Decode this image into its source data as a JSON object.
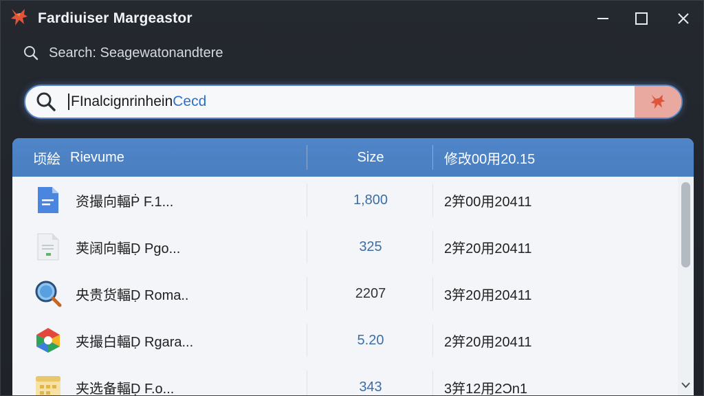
{
  "window": {
    "title": "Fardiuiser Margeastor",
    "colors": {
      "accent": "#4a7fc0",
      "logo": "#e0553a"
    }
  },
  "search_hint": {
    "icon": "search-icon",
    "text": "Search: Seagewatonandtere"
  },
  "search": {
    "value_part1": "FInalcignrinhein",
    "value_part2": "Cecd",
    "icon": "search-icon"
  },
  "table": {
    "headers": {
      "name_prefix": "顷絵",
      "name": "Rievume",
      "size": "Size",
      "modified": "修改00用20.15"
    },
    "rows": [
      {
        "icon": "document-icon",
        "name": "资撮向輻Ṗ F.1...",
        "size": "1,800",
        "size_color": "#3a6ea8",
        "modified": "2笄00用20411"
      },
      {
        "icon": "text-file-icon",
        "name": "荚阔向輻Ḍ Pgo...",
        "size": "325",
        "size_color": "#3a6ea8",
        "modified": "2笄20用20411"
      },
      {
        "icon": "magnifier-app-icon",
        "name": "央贵货輻Ḍ Roma..",
        "size": "2207",
        "size_color": "#333333",
        "modified": "3笄20用20411"
      },
      {
        "icon": "chrome-like-icon",
        "name": "夹撮白輻Ḍ Rgara...",
        "size": "5.20",
        "size_color": "#3a6ea8",
        "modified": "2笄20用20411"
      },
      {
        "icon": "spreadsheet-icon",
        "name": "夹选备輻Ḍ F.o...",
        "size": "343",
        "size_color": "#3a6ea8",
        "modified": "3笄12用2Ɔn1"
      }
    ]
  }
}
